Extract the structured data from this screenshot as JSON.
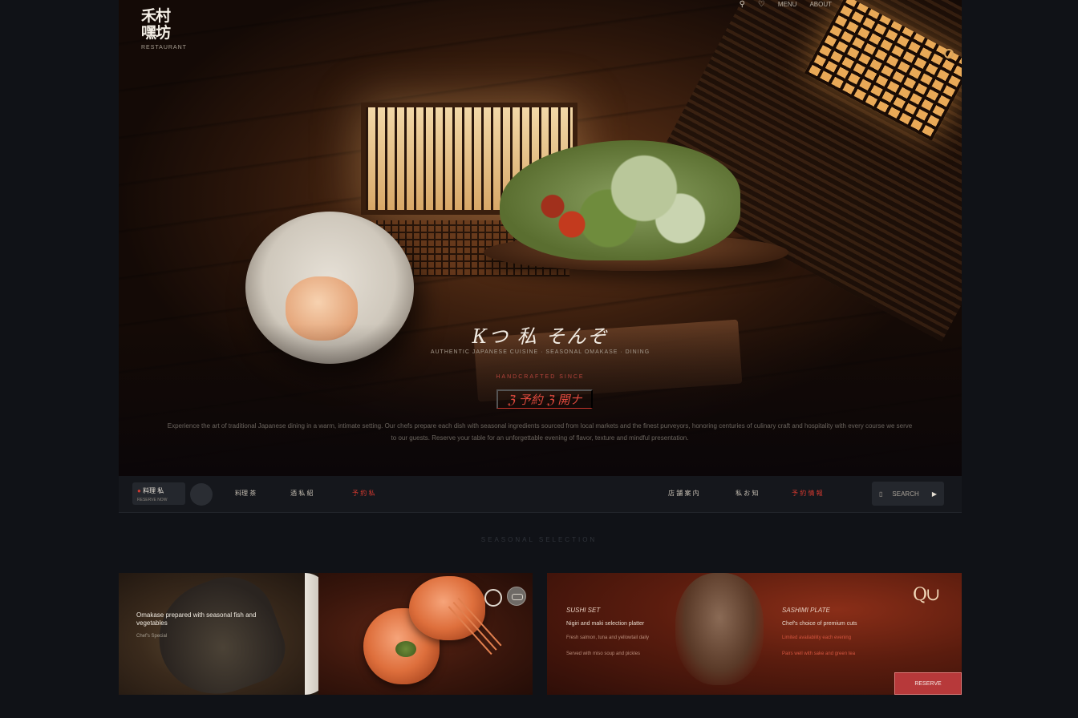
{
  "brand": {
    "logo_text": "禾村 嘿坊",
    "subtitle": "RESTAURANT"
  },
  "top_nav": {
    "search_icon": "search-icon",
    "heart_icon": "heart-icon",
    "links": [
      "MENU",
      "ABOUT"
    ]
  },
  "hero": {
    "title": "Кつ 私 そんぞ",
    "subtitle": "AUTHENTIC JAPANESE CUISINE · SEASONAL OMAKASE · DINING",
    "small_red": "HANDCRAFTED SINCE",
    "cta": "ℨ 予約 ℨ 開ナ",
    "description": "Experience the art of traditional Japanese dining in a warm, intimate setting. Our chefs prepare each dish with seasonal ingredients sourced from local markets and the finest purveyors, honoring centuries of culinary craft and hospitality with every course we serve to our guests. Reserve your table for an unforgettable evening of flavor, texture and mindful presentation."
  },
  "navbar": {
    "badge_title": "料理 私",
    "badge_sub": "RESERVE NOW",
    "left_links": [
      {
        "label": "料理 茶"
      },
      {
        "label": "酒 私 紹"
      },
      {
        "label": "予 約 私",
        "active": true
      }
    ],
    "right_links": [
      {
        "label": "店 舗 案 内"
      },
      {
        "label": "私 お 知"
      },
      {
        "label": "予 約 情 報",
        "active": true
      }
    ],
    "search_label": "SEARCH",
    "accent": "#d2392f"
  },
  "section_heading": "SEASONAL SELECTION",
  "card_left": {
    "title": "Omakase prepared with seasonal fish and vegetables",
    "caption": "Chef's Special"
  },
  "card_right": {
    "col1": {
      "heading": "SUSHI SET",
      "subtitle": "Nigiri and maki selection platter",
      "lines": [
        "Fresh salmon, tuna and yellowtail daily",
        "Served with miso soup and pickles"
      ]
    },
    "col2": {
      "heading": "SASHIMI PLATE",
      "subtitle": "Chef's choice of premium cuts",
      "lines": [
        "Limited availability each evening",
        "Pairs well with sake and green tea"
      ]
    },
    "emblem": "Q∪",
    "cta": "RESERVE"
  },
  "colors": {
    "background": "#101217",
    "accent_red": "#d2392f",
    "wood": "#4a2712",
    "cta_red": "#b7393a"
  }
}
